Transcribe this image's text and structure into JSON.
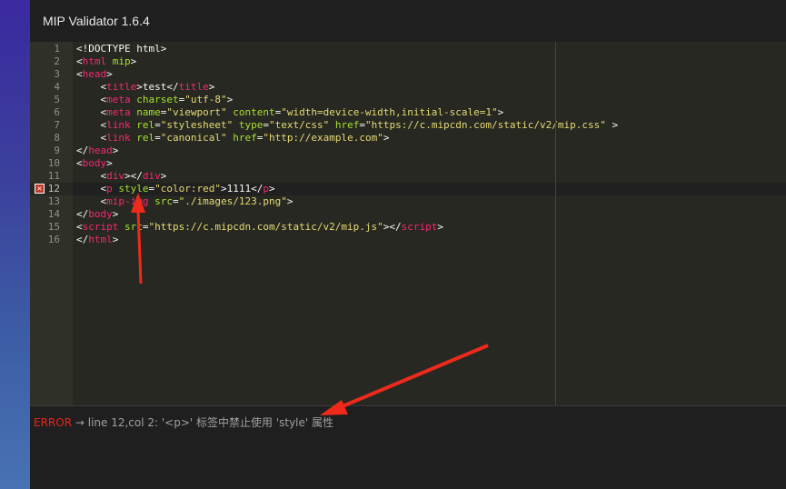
{
  "window": {
    "title": "MIP Validator 1.6.4"
  },
  "editor": {
    "active_line": 12,
    "lines": [
      {
        "num": "1",
        "tokens": [
          [
            "t",
            "<!DOCTYPE html>"
          ]
        ]
      },
      {
        "num": "2",
        "tokens": [
          [
            "t",
            "<"
          ],
          [
            "g",
            "html"
          ],
          [
            "t",
            " "
          ],
          [
            "a",
            "mip"
          ],
          [
            "t",
            ">"
          ]
        ]
      },
      {
        "num": "3",
        "tokens": [
          [
            "t",
            "<"
          ],
          [
            "g",
            "head"
          ],
          [
            "t",
            ">"
          ]
        ]
      },
      {
        "num": "4",
        "tokens": [
          [
            "t",
            "    <"
          ],
          [
            "g",
            "title"
          ],
          [
            "t",
            ">test</"
          ],
          [
            "g",
            "title"
          ],
          [
            "t",
            ">"
          ]
        ]
      },
      {
        "num": "5",
        "tokens": [
          [
            "t",
            "    <"
          ],
          [
            "g",
            "meta"
          ],
          [
            "t",
            " "
          ],
          [
            "a",
            "charset"
          ],
          [
            "t",
            "="
          ],
          [
            "s",
            "\"utf-8\""
          ],
          [
            "t",
            ">"
          ]
        ]
      },
      {
        "num": "6",
        "tokens": [
          [
            "t",
            "    <"
          ],
          [
            "g",
            "meta"
          ],
          [
            "t",
            " "
          ],
          [
            "a",
            "name"
          ],
          [
            "t",
            "="
          ],
          [
            "s",
            "\"viewport\""
          ],
          [
            "t",
            " "
          ],
          [
            "a",
            "content"
          ],
          [
            "t",
            "="
          ],
          [
            "s",
            "\"width=device-width,initial-scale=1\""
          ],
          [
            "t",
            ">"
          ]
        ]
      },
      {
        "num": "7",
        "tokens": [
          [
            "t",
            "    <"
          ],
          [
            "g",
            "link"
          ],
          [
            "t",
            " "
          ],
          [
            "a",
            "rel"
          ],
          [
            "t",
            "="
          ],
          [
            "s",
            "\"stylesheet\""
          ],
          [
            "t",
            " "
          ],
          [
            "a",
            "type"
          ],
          [
            "t",
            "="
          ],
          [
            "s",
            "\"text/css\""
          ],
          [
            "t",
            " "
          ],
          [
            "a",
            "href"
          ],
          [
            "t",
            "="
          ],
          [
            "s",
            "\"https://c.mipcdn.com/static/v2/mip.css\""
          ],
          [
            "t",
            " >"
          ]
        ]
      },
      {
        "num": "8",
        "tokens": [
          [
            "t",
            "    <"
          ],
          [
            "g",
            "link"
          ],
          [
            "t",
            " "
          ],
          [
            "a",
            "rel"
          ],
          [
            "t",
            "="
          ],
          [
            "s",
            "\"canonical\""
          ],
          [
            "t",
            " "
          ],
          [
            "a",
            "href"
          ],
          [
            "t",
            "="
          ],
          [
            "s",
            "\"http://example.com\""
          ],
          [
            "t",
            ">"
          ]
        ]
      },
      {
        "num": "9",
        "tokens": [
          [
            "t",
            "</"
          ],
          [
            "g",
            "head"
          ],
          [
            "t",
            ">"
          ]
        ]
      },
      {
        "num": "10",
        "tokens": [
          [
            "t",
            "<"
          ],
          [
            "g",
            "body"
          ],
          [
            "t",
            ">"
          ]
        ]
      },
      {
        "num": "11",
        "tokens": [
          [
            "t",
            "    <"
          ],
          [
            "g",
            "div"
          ],
          [
            "t",
            "></"
          ],
          [
            "g",
            "div"
          ],
          [
            "t",
            ">"
          ]
        ]
      },
      {
        "num": "12",
        "tokens": [
          [
            "t",
            "    <"
          ],
          [
            "g",
            "p"
          ],
          [
            "t",
            " "
          ],
          [
            "a",
            "style"
          ],
          [
            "t",
            "="
          ],
          [
            "s",
            "\"color:red\""
          ],
          [
            "t",
            ">1111</"
          ],
          [
            "g",
            "p"
          ],
          [
            "t",
            ">"
          ]
        ]
      },
      {
        "num": "13",
        "tokens": [
          [
            "t",
            "    <"
          ],
          [
            "g",
            "mip-img"
          ],
          [
            "t",
            " "
          ],
          [
            "a",
            "src"
          ],
          [
            "t",
            "="
          ],
          [
            "s",
            "\"./images/123.png\""
          ],
          [
            "t",
            ">"
          ]
        ]
      },
      {
        "num": "14",
        "tokens": [
          [
            "t",
            "</"
          ],
          [
            "g",
            "body"
          ],
          [
            "t",
            ">"
          ]
        ]
      },
      {
        "num": "15",
        "tokens": [
          [
            "t",
            "<"
          ],
          [
            "g",
            "script"
          ],
          [
            "t",
            " "
          ],
          [
            "a",
            "src"
          ],
          [
            "t",
            "="
          ],
          [
            "s",
            "\"https://c.mipcdn.com/static/v2/mip.js\""
          ],
          [
            "t",
            "></"
          ],
          [
            "g",
            "script"
          ],
          [
            "t",
            ">"
          ]
        ]
      },
      {
        "num": "16",
        "tokens": [
          [
            "t",
            "</"
          ],
          [
            "g",
            "html"
          ],
          [
            "t",
            ">"
          ]
        ]
      }
    ],
    "error_icon": "error-x-icon"
  },
  "status": {
    "error_label": "ERROR",
    "error_text": " → line 12,col 2: '<p>' 标签中禁止使用 'style' 属性"
  },
  "colors": {
    "tag": "#f92672",
    "attr": "#a6e22e",
    "string": "#e6db74",
    "text": "#f8f8f2",
    "error": "#e8221c",
    "arrow": "#ee2a1c"
  }
}
